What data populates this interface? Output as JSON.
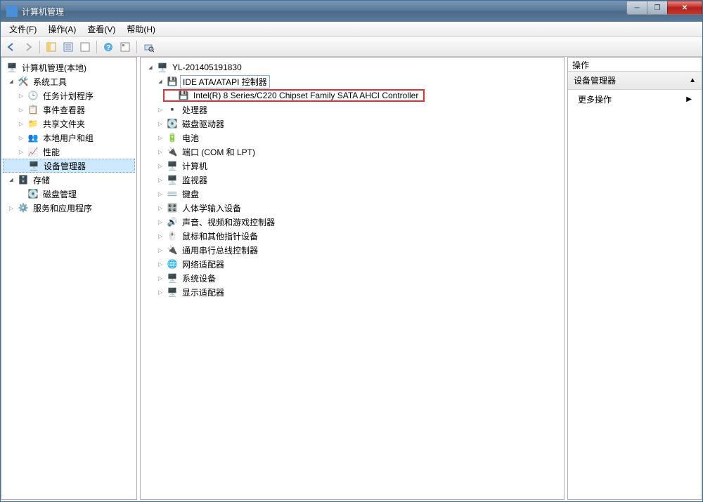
{
  "window": {
    "title": "计算机管理"
  },
  "menu": {
    "file": "文件(F)",
    "action": "操作(A)",
    "view": "查看(V)",
    "help": "帮助(H)"
  },
  "left_tree": {
    "root": "计算机管理(本地)",
    "system_tools": "系统工具",
    "task_scheduler": "任务计划程序",
    "event_viewer": "事件查看器",
    "shared_folders": "共享文件夹",
    "local_users": "本地用户和组",
    "performance": "性能",
    "device_manager": "设备管理器",
    "storage": "存储",
    "disk_management": "磁盘管理",
    "services": "服务和应用程序"
  },
  "mid_tree": {
    "computer": "YL-201405191830",
    "ide_ata": "IDE ATA/ATAPI 控制器",
    "sata_controller": "Intel(R) 8 Series/C220 Chipset Family SATA AHCI Controller",
    "processor": "处理器",
    "disk_drives": "磁盘驱动器",
    "battery": "电池",
    "ports": "端口 (COM 和 LPT)",
    "computers": "计算机",
    "monitors": "监视器",
    "keyboards": "键盘",
    "hid": "人体学输入设备",
    "sound": "声音、视频和游戏控制器",
    "mice": "鼠标和其他指针设备",
    "usb": "通用串行总线控制器",
    "network": "网络适配器",
    "system_devices": "系统设备",
    "display": "显示适配器"
  },
  "right": {
    "header": "操作",
    "section": "设备管理器",
    "more_actions": "更多操作"
  }
}
